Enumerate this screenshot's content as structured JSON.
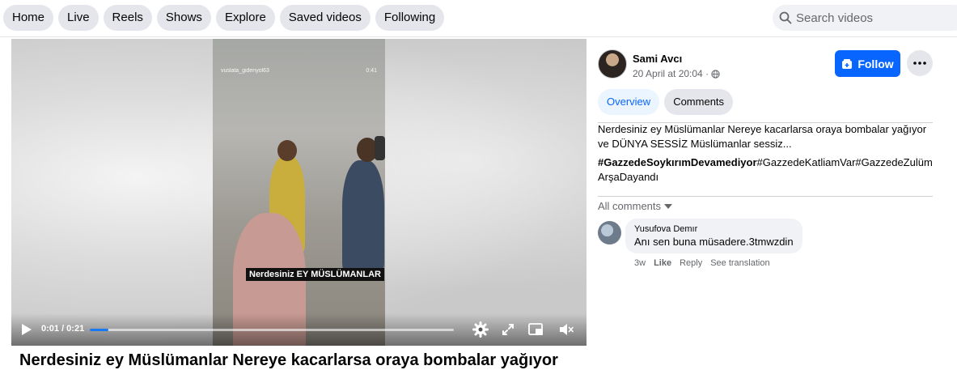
{
  "nav": {
    "tabs": [
      "Home",
      "Live",
      "Reels",
      "Shows",
      "Explore",
      "Saved videos",
      "Following"
    ],
    "search_placeholder": "Search videos"
  },
  "video": {
    "watermark": "vuslata_gidenyol63",
    "overlay_time": "0:41",
    "caption": "Nerdesiniz EY MÜSLÜMANLAR",
    "time_display": "0:01 / 0:21",
    "progress_fraction": 0.05,
    "title": "Nerdesiniz ey Müslümanlar Nereye kacarlarsa oraya bombalar yağıyor"
  },
  "post": {
    "author": "Sami Avcı",
    "date": "20 April at 20:04 ·",
    "follow_label": "Follow",
    "tabs": {
      "overview": "Overview",
      "comments": "Comments"
    },
    "description": "Nerdesiniz ey Müslümanlar Nereye kacarlarsa oraya bombalar yağıyor ve DÜNYA SESSİZ Müslümanlar sessiz...",
    "hashtag_bold": "#GazzedeSoykırımDevamediyor",
    "hashtags_rest": "#GazzedeKatliamVar#GazzedeZulüm ArşaDayandı",
    "all_comments": "All comments"
  },
  "comment": {
    "name": "Yusufova Demır",
    "text": "Anı sen buna müsadere.3tmwzdin",
    "age": "3w",
    "like": "Like",
    "reply": "Reply",
    "translate": "See translation"
  },
  "colors": {
    "accent": "#0866ff",
    "tab_bg": "#e4e6eb",
    "progress": "#1877f2"
  }
}
